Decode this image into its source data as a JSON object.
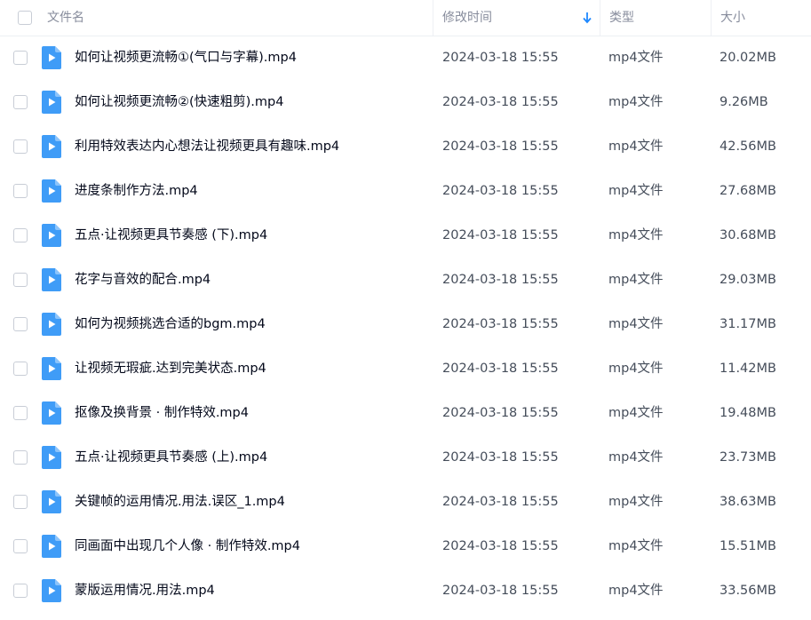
{
  "header": {
    "name_label": "文件名",
    "time_label": "修改时间",
    "type_label": "类型",
    "size_label": "大小",
    "sort_icon": "arrow-down-icon"
  },
  "colors": {
    "accent": "#1e88ff",
    "file_icon": "#3f9cf7",
    "header_text": "#878c9c",
    "name_text": "#03081a",
    "meta_text": "#454d5a"
  },
  "files": [
    {
      "name": "如何让视频更流畅①(气口与字幕).mp4",
      "time": "2024-03-18 15:55",
      "type": "mp4文件",
      "size": "20.02MB"
    },
    {
      "name": "如何让视频更流畅②(快速粗剪).mp4",
      "time": "2024-03-18 15:55",
      "type": "mp4文件",
      "size": "9.26MB"
    },
    {
      "name": "利用特效表达内心想法让视频更具有趣味.mp4",
      "time": "2024-03-18 15:55",
      "type": "mp4文件",
      "size": "42.56MB"
    },
    {
      "name": "进度条制作方法.mp4",
      "time": "2024-03-18 15:55",
      "type": "mp4文件",
      "size": "27.68MB"
    },
    {
      "name": "五点·让视频更具节奏感 (下).mp4",
      "time": "2024-03-18 15:55",
      "type": "mp4文件",
      "size": "30.68MB"
    },
    {
      "name": "花字与音效的配合.mp4",
      "time": "2024-03-18 15:55",
      "type": "mp4文件",
      "size": "29.03MB"
    },
    {
      "name": "如何为视频挑选合适的bgm.mp4",
      "time": "2024-03-18 15:55",
      "type": "mp4文件",
      "size": "31.17MB"
    },
    {
      "name": "让视频无瑕疵.达到完美状态.mp4",
      "time": "2024-03-18 15:55",
      "type": "mp4文件",
      "size": "11.42MB"
    },
    {
      "name": "抠像及换背景 · 制作特效.mp4",
      "time": "2024-03-18 15:55",
      "type": "mp4文件",
      "size": "19.48MB"
    },
    {
      "name": "五点·让视频更具节奏感 (上).mp4",
      "time": "2024-03-18 15:55",
      "type": "mp4文件",
      "size": "23.73MB"
    },
    {
      "name": "关键帧的运用情况.用法.误区_1.mp4",
      "time": "2024-03-18 15:55",
      "type": "mp4文件",
      "size": "38.63MB"
    },
    {
      "name": "同画面中出现几个人像 · 制作特效.mp4",
      "time": "2024-03-18 15:55",
      "type": "mp4文件",
      "size": "15.51MB"
    },
    {
      "name": "蒙版运用情况.用法.mp4",
      "time": "2024-03-18 15:55",
      "type": "mp4文件",
      "size": "33.56MB"
    }
  ]
}
